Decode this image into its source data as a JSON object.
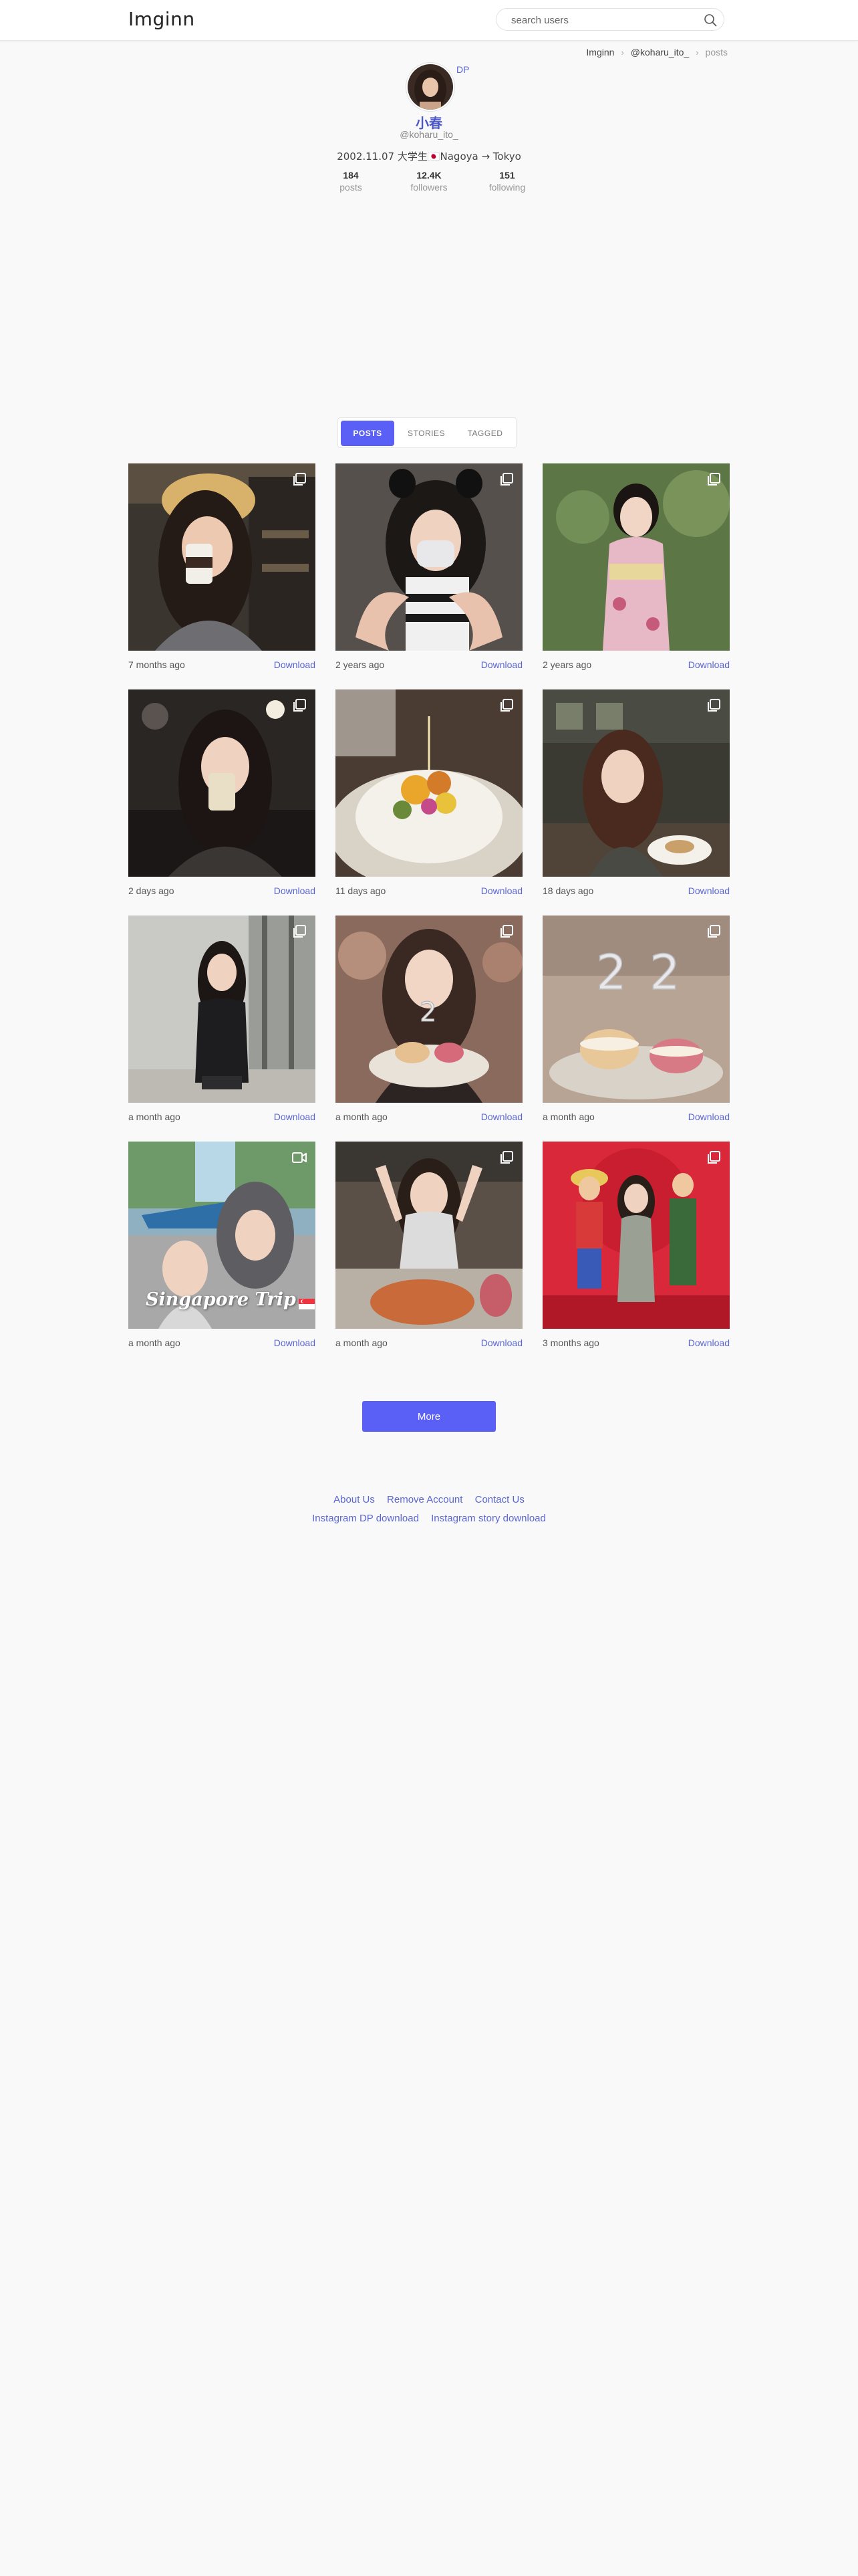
{
  "header": {
    "logo": "Imginn",
    "search_placeholder": "search users",
    "search_icon": "search-icon"
  },
  "breadcrumb": {
    "items": [
      "Imginn",
      "@koharu_ito_"
    ],
    "current": "posts",
    "separator_icon": "chevron-right-icon"
  },
  "profile": {
    "dp_link": "DP",
    "name": "小春",
    "username": "@koharu_ito_",
    "bio": "2002.11.07 大学生🇯🇵Nagoya → Tokyo",
    "stats": [
      {
        "value": "184",
        "label": "posts"
      },
      {
        "value": "12.4K",
        "label": "followers"
      },
      {
        "value": "151",
        "label": "following"
      }
    ]
  },
  "tabs": [
    {
      "label": "POSTS",
      "active": true
    },
    {
      "label": "STORIES",
      "active": false
    },
    {
      "label": "TAGGED",
      "active": false
    }
  ],
  "posts": [
    {
      "time": "7 months ago",
      "download": "Download",
      "type_icon": "gallery-icon"
    },
    {
      "time": "2 years ago",
      "download": "Download",
      "type_icon": "gallery-icon"
    },
    {
      "time": "2 years ago",
      "download": "Download",
      "type_icon": "gallery-icon"
    },
    {
      "time": "2 days ago",
      "download": "Download",
      "type_icon": "gallery-icon"
    },
    {
      "time": "11 days ago",
      "download": "Download",
      "type_icon": "gallery-icon"
    },
    {
      "time": "18 days ago",
      "download": "Download",
      "type_icon": "gallery-icon"
    },
    {
      "time": "a month ago",
      "download": "Download",
      "type_icon": "gallery-icon"
    },
    {
      "time": "a month ago",
      "download": "Download",
      "type_icon": "gallery-icon"
    },
    {
      "time": "a month ago",
      "download": "Download",
      "type_icon": "gallery-icon"
    },
    {
      "time": "a month ago",
      "download": "Download",
      "type_icon": "video-icon",
      "overlay_text": "Singapore Trip"
    },
    {
      "time": "a month ago",
      "download": "Download",
      "type_icon": "gallery-icon"
    },
    {
      "time": "3 months ago",
      "download": "Download",
      "type_icon": "gallery-icon"
    }
  ],
  "more_button": "More",
  "footer": {
    "row1": [
      "About Us",
      "Remove Account",
      "Contact Us"
    ],
    "row2": [
      "Instagram DP download",
      "Instagram story download"
    ]
  },
  "colors": {
    "accent": "#5a5ff5",
    "link": "#5a66d6",
    "name": "#4b57c8",
    "page_bg": "#f9f9f9"
  }
}
